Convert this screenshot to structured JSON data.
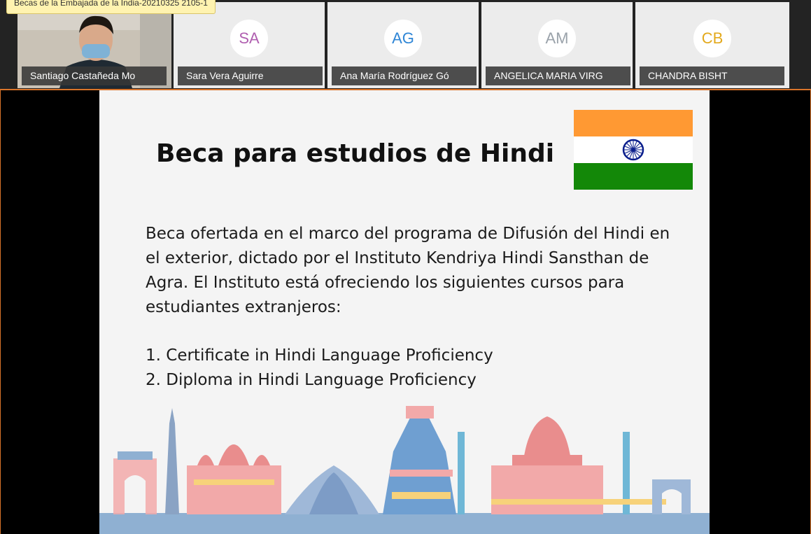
{
  "meeting": {
    "recording_tooltip": "Becas de la Embajada de la India-20210325 2105-1"
  },
  "participants": [
    {
      "name": "Santiago Castañeda Mo",
      "initials": "",
      "video": true,
      "color": "#5b6770"
    },
    {
      "name": "Sara Vera Aguirre",
      "initials": "SA",
      "video": false,
      "color": "#b05fb0"
    },
    {
      "name": "Ana María Rodríguez Gó",
      "initials": "AG",
      "video": false,
      "color": "#2f86d6"
    },
    {
      "name": "ANGELICA MARIA VIRG",
      "initials": "AM",
      "video": false,
      "color": "#9aa2aa"
    },
    {
      "name": "CHANDRA BISHT",
      "initials": "CB",
      "video": false,
      "color": "#e3a91c"
    }
  ],
  "slide": {
    "title": "Beca para estudios de Hindi",
    "paragraph": "Beca ofertada en el marco del programa de Difusión del Hindi en el exterior, dictado por el Instituto Kendriya Hindi Sansthan de Agra. El Instituto está ofreciendo los siguientes cursos para estudiantes extranjeros:",
    "courses": [
      "1. Certificate in Hindi Language Proficiency",
      "2. Diploma in Hindi Language Proficiency"
    ],
    "flag_colors": {
      "saffron": "#ff9933",
      "white": "#ffffff",
      "green": "#138808",
      "chakra": "#0a1e8c"
    }
  }
}
